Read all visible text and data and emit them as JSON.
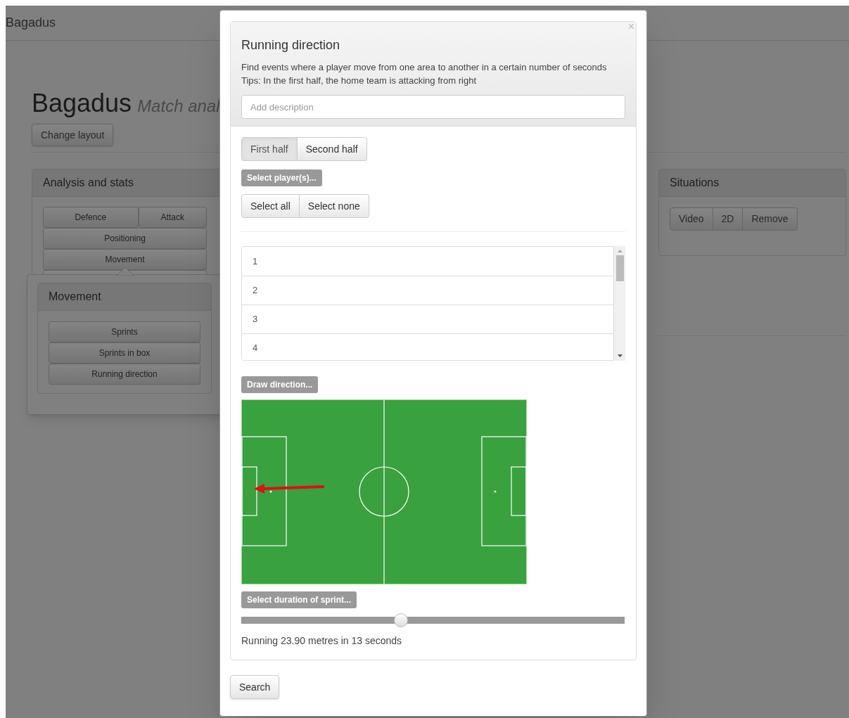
{
  "navbar": {
    "brand": "Bagadus"
  },
  "header": {
    "title": "Bagadus",
    "subtitle": "Match anal"
  },
  "change_layout_button": "Change layout",
  "analysis_panel": {
    "title": "Analysis and stats",
    "button_rows": [
      [
        "Defence",
        "Attack"
      ],
      [
        "Positioning"
      ],
      [
        "Movement"
      ]
    ]
  },
  "popover": {
    "title": "Movement",
    "items": [
      "Sprints",
      "Sprints in box",
      "Running direction"
    ]
  },
  "situations_panel": {
    "title": "Situations",
    "buttons": [
      "Video",
      "2D",
      "Remove"
    ]
  },
  "modal": {
    "close": "×",
    "title": "Running direction",
    "description": "Find events where a player move from one area to another in a certain number of seconds",
    "tip": "Tips: In the first half, the home team is attacking from right",
    "description_field": {
      "placeholder": "Add description"
    },
    "half_tabs": [
      {
        "label": "First half",
        "selected": true
      },
      {
        "label": "Second half",
        "selected": false
      }
    ],
    "players_label": "Select player(s)...",
    "select_buttons": [
      "Select all",
      "Select none"
    ],
    "players": [
      "1",
      "2",
      "3",
      "4"
    ],
    "direction_label": "Draw direction...",
    "duration_label": "Select duration of sprint...",
    "duration_slider": {
      "level": 0.417
    },
    "duration_reading": "Running 23.90 metres in 13 seconds",
    "search_button": "Search"
  }
}
